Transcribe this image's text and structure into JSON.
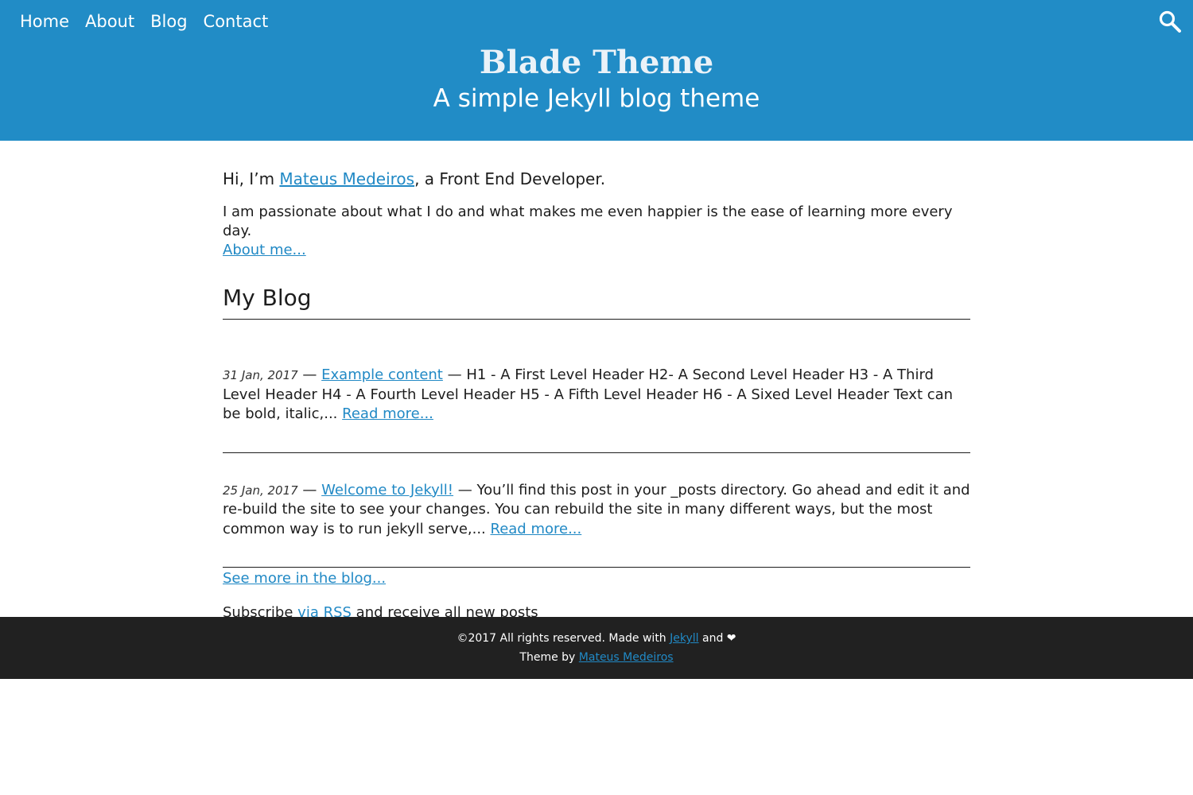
{
  "nav": {
    "items": [
      {
        "label": "Home"
      },
      {
        "label": "About"
      },
      {
        "label": "Blog"
      },
      {
        "label": "Contact"
      }
    ],
    "search_icon": "search-icon"
  },
  "header": {
    "title": "Blade Theme",
    "subtitle": "A simple Jekyll blog theme"
  },
  "intro": {
    "prefix": "Hi, I’m ",
    "name": "Mateus Medeiros",
    "suffix": ", a Front End Developer.",
    "passion": "I am passionate about what I do and what makes me even happier is the ease of learning more every day.",
    "about_link": "About me..."
  },
  "blog": {
    "heading": "My Blog",
    "separator": " — ",
    "posts": [
      {
        "date": "31 Jan, 2017",
        "title": "Example content",
        "excerpt": "H1 - A First Level Header H2- A Second Level Header H3 - A Third Level Header H4 - A Fourth Level Header H5 - A Fifth Level Header H6 - A Sixed Level Header Text can be bold, italic,... ",
        "read_more": "Read more..."
      },
      {
        "date": "25 Jan, 2017",
        "title": "Welcome to Jekyll!",
        "excerpt": "You’ll find this post in your _posts directory. Go ahead and edit it and re-build the site to see your changes. You can rebuild the site in many different ways, but the most common way is to run jekyll serve,... ",
        "read_more": "Read more..."
      }
    ],
    "see_more": "See more in the blog..."
  },
  "subscribe": {
    "prefix": "Subscribe ",
    "link": "via RSS",
    "suffix": " and receive all new posts"
  },
  "footer": {
    "line1_prefix": "©2017 All rights reserved. Made with ",
    "line1_link": "Jekyll",
    "line1_suffix": " and ❤",
    "line2_prefix": "Theme by ",
    "line2_link": "Mateus Medeiros"
  },
  "colors": {
    "header_bg": "#218cc6",
    "link": "#2189c5",
    "footer_bg": "#212121",
    "text": "#1d1d1d"
  }
}
